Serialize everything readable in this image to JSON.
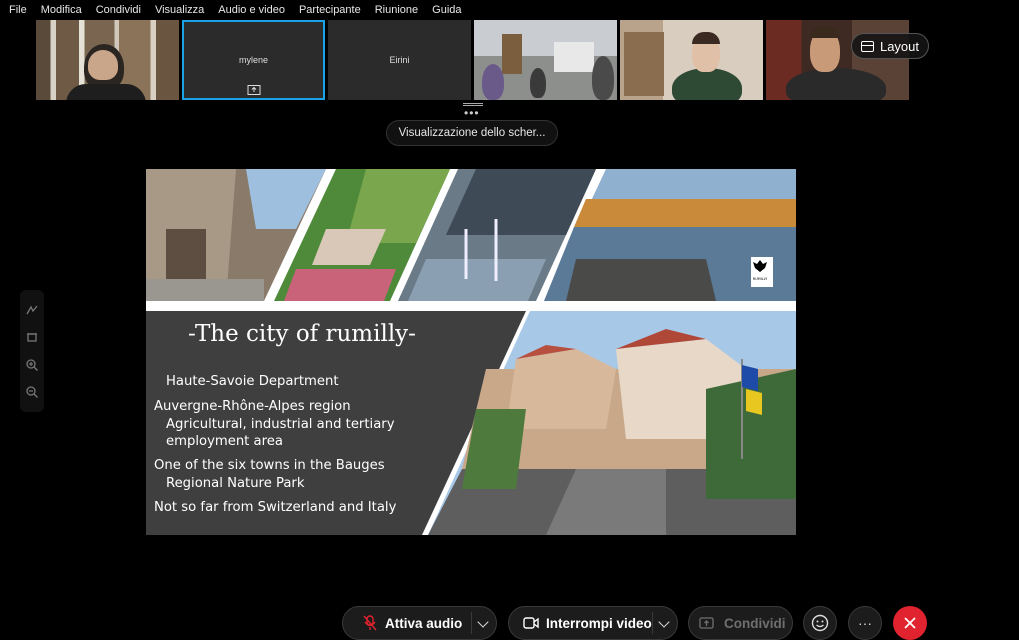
{
  "menu": {
    "items": [
      "File",
      "Modifica",
      "Condividi",
      "Visualizza",
      "Audio e video",
      "Partecipante",
      "Riunione",
      "Guida"
    ]
  },
  "participants": [
    {
      "type": "video",
      "icon": "participant-video"
    },
    {
      "type": "name",
      "name": "mylene",
      "active": true
    },
    {
      "type": "name",
      "name": "Eirini",
      "active": false
    },
    {
      "type": "video",
      "icon": "participant-video"
    },
    {
      "type": "video",
      "icon": "participant-video"
    },
    {
      "type": "video",
      "icon": "participant-video"
    }
  ],
  "layout_button": {
    "label": "Layout",
    "icon": "layout-icon"
  },
  "share_label": "Visualizzazione dello scher...",
  "left_tools": [
    "annotate-icon",
    "eraser-icon",
    "zoom-in-icon",
    "zoom-out-icon"
  ],
  "slide": {
    "title": "-The city of rumilly-",
    "lines": [
      "Haute-Savoie Department",
      "Auvergne-Rhône-Alpes region",
      "Agricultural, industrial and tertiary",
      "employment area",
      "One of the six towns in the Bauges",
      "Regional Nature Park",
      "Not so far from Switzerland and Italy"
    ],
    "logo_caption": "RUMILLY"
  },
  "controls": {
    "audio_label": "Attiva audio",
    "video_label": "Interrompi video",
    "share_label": "Condividi",
    "more_label": "···"
  },
  "colors": {
    "accent": "#19a3e6",
    "end_call": "#e0232e",
    "slide_panel": "#3f3f3f"
  }
}
